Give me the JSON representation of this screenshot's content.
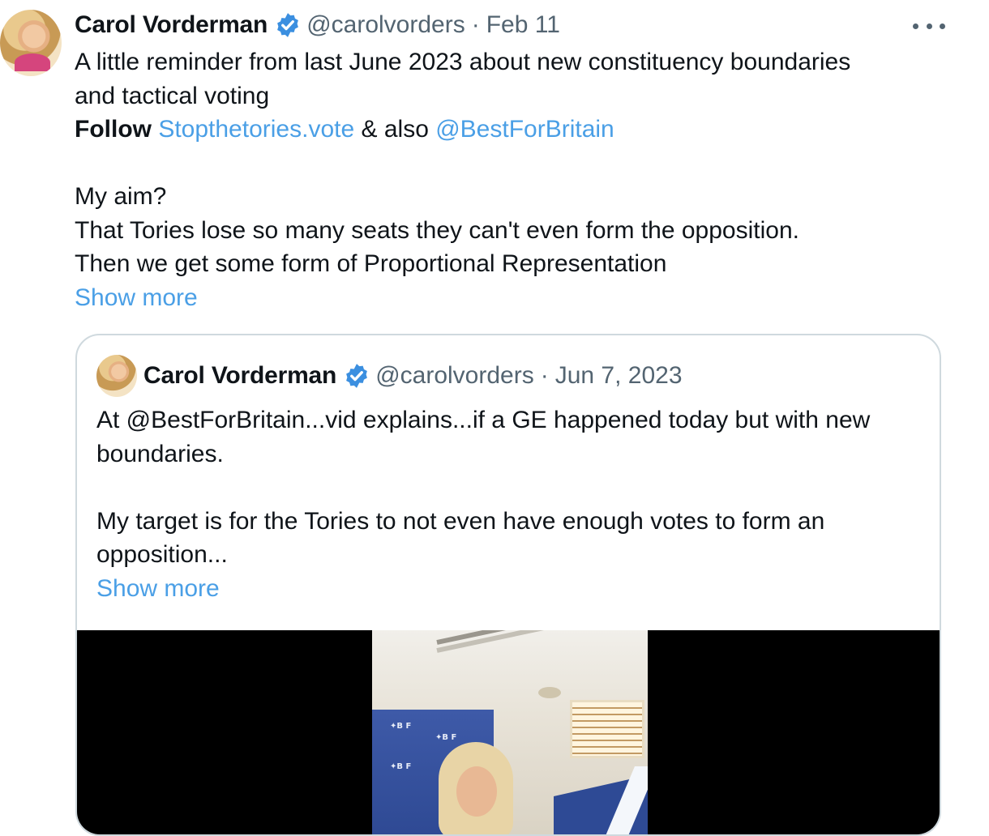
{
  "tweet": {
    "author_name": "Carol Vorderman",
    "handle": "@carolvorders",
    "separator": "·",
    "date": "Feb 11",
    "line1": "A little reminder from last June 2023 about new constituency boundaries",
    "line2": "and tactical voting",
    "follow_label": "Follow",
    "link1": "Stopthetories.vote",
    "also_text": " & also ",
    "link2": "@BestForBritain",
    "line_aim": "My aim?",
    "line_seats": "That Tories lose so many seats they can't even form the opposition.",
    "line_pr": "Then we get some form of Proportional Representation",
    "show_more": "Show more"
  },
  "quoted": {
    "author_name": "Carol Vorderman",
    "handle": "@carolvorders",
    "separator": "·",
    "date": "Jun 7, 2023",
    "line1": "At @BestForBritain...vid explains...if a GE happened today but with new",
    "line2": "boundaries.",
    "line3": "My target is for the Tories to not even have enough votes to form an",
    "line4": "opposition...",
    "show_more": "Show more"
  },
  "icons": {
    "verified": "verified-badge-icon",
    "more": "more-options-icon"
  },
  "colors": {
    "text": "#0f1419",
    "secondary": "#536471",
    "link": "#4a9fe6",
    "verified": "#3b8fe0",
    "border": "#cfd9de"
  }
}
